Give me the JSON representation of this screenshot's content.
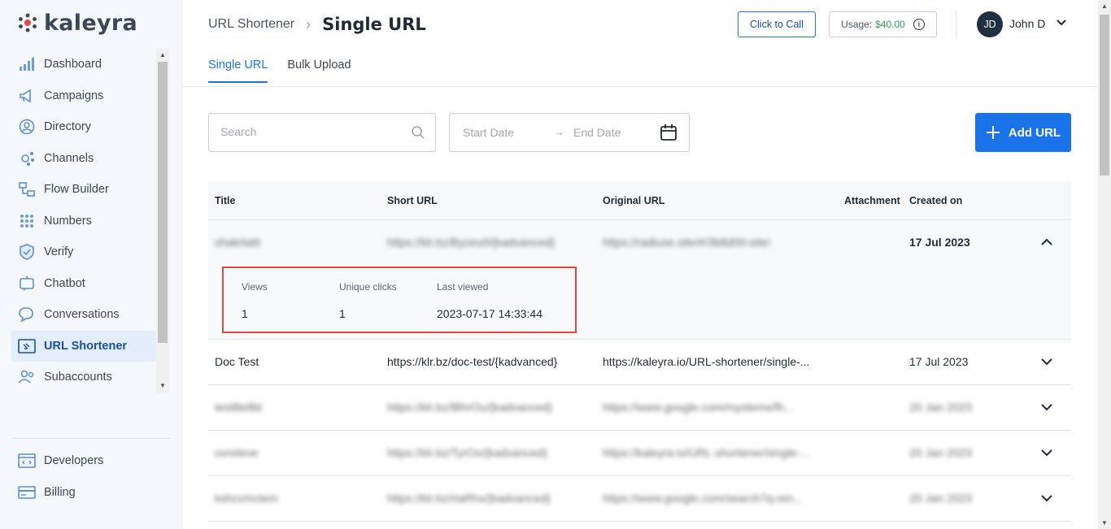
{
  "brand": {
    "name": "kaleyra"
  },
  "sidebar": {
    "items": [
      {
        "label": "Dashboard",
        "icon": "dashboard-icon"
      },
      {
        "label": "Campaigns",
        "icon": "megaphone-icon"
      },
      {
        "label": "Directory",
        "icon": "directory-icon"
      },
      {
        "label": "Channels",
        "icon": "channels-icon"
      },
      {
        "label": "Flow Builder",
        "icon": "flow-builder-icon"
      },
      {
        "label": "Numbers",
        "icon": "numbers-icon"
      },
      {
        "label": "Verify",
        "icon": "shield-icon"
      },
      {
        "label": "Chatbot",
        "icon": "chatbot-icon"
      },
      {
        "label": "Conversations",
        "icon": "conversations-icon"
      },
      {
        "label": "URL Shortener",
        "icon": "url-shortener-icon",
        "active": true
      },
      {
        "label": "Subaccounts",
        "icon": "subaccounts-icon"
      }
    ],
    "bottom_items": [
      {
        "label": "Developers",
        "icon": "developers-icon"
      },
      {
        "label": "Billing",
        "icon": "billing-icon"
      }
    ]
  },
  "header": {
    "breadcrumb_parent": "URL Shortener",
    "breadcrumb_current": "Single URL",
    "click_to_call": "Click to Call",
    "usage_label": "Usage:",
    "usage_amount": "$40.00",
    "user_initials": "JD",
    "user_name": "John D",
    "tabs": [
      {
        "label": "Single URL",
        "active": true
      },
      {
        "label": "Bulk Upload",
        "active": false
      }
    ]
  },
  "filters": {
    "search_placeholder": "Search",
    "start_date": "Start Date",
    "end_date": "End Date",
    "add_url": "Add URL"
  },
  "table": {
    "columns": [
      "Title",
      "Short URL",
      "Original URL",
      "Attachment",
      "Created on"
    ],
    "expanded_row": {
      "title": "shakrlatit",
      "short_url": "https://klr.bz/Byzeu0/{kadvanced}",
      "original_url": "https://radiuse.site/#/3b8d00-site/",
      "created_on": "17 Jul 2023",
      "stats": {
        "views_label": "Views",
        "unique_label": "Unique clicks",
        "last_viewed_label": "Last viewed",
        "views": "1",
        "unique": "1",
        "last_viewed": "2023-07-17 14:33:44"
      }
    },
    "rows": [
      {
        "title": "Doc Test",
        "short_url": "https://klr.bz/doc-test/{kadvanced}",
        "original_url": "https://kaleyra.io/URL-shortener/single-...",
        "created_on": "17 Jul 2023",
        "blurred": false
      },
      {
        "title": "testlltellld",
        "short_url": "https://klr.bz/lBhrOu/{kadvanced}",
        "original_url": "https://www.google.com/mystems/fh...",
        "created_on": "20 Jan 2023",
        "blurred": true
      },
      {
        "title": "ovreteve",
        "short_url": "https://klr.bz/TyrOx/{kadvanced}",
        "original_url": "https://kaleyra.io/URL-shortener/single-...",
        "created_on": "20 Jan 2023",
        "blurred": true
      },
      {
        "title": "kshcvmctem",
        "short_url": "https://klr.bz/rtaRhs/{kadvanced}",
        "original_url": "https://www.google.com/search?q-ren...",
        "created_on": "20 Jan 2023",
        "blurred": true
      }
    ]
  }
}
